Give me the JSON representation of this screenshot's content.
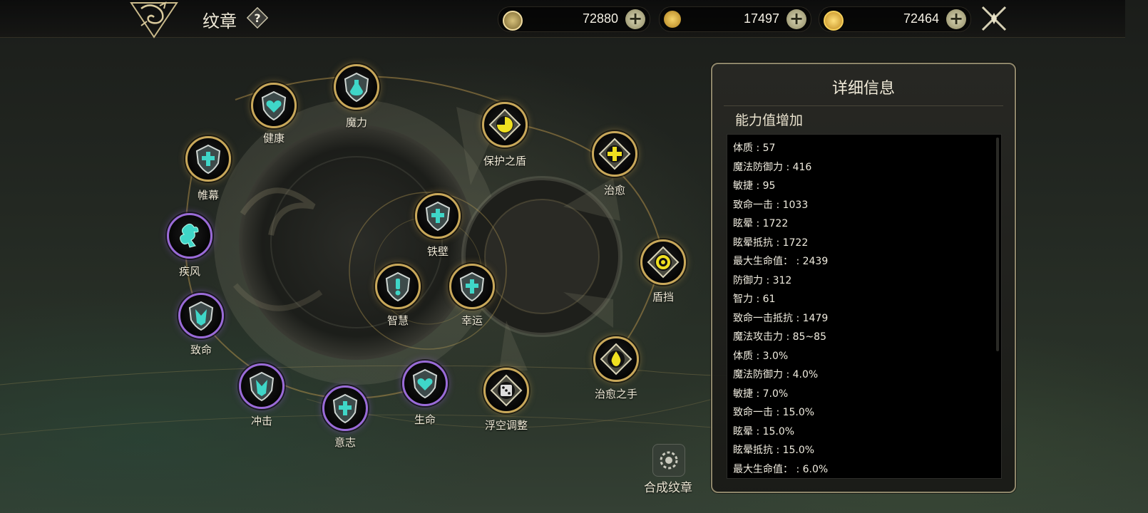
{
  "header": {
    "title": "纹章",
    "help_icon": "question-icon",
    "currencies": [
      {
        "name": "c1",
        "icon": "swirl-coin-icon",
        "value": "72880"
      },
      {
        "name": "c2",
        "icon": "gold-coin-bag-icon",
        "value": "17497"
      },
      {
        "name": "c3",
        "icon": "gold-coin-icon",
        "value": "72464"
      }
    ],
    "close_icon": "crossed-swords-close-icon"
  },
  "emblems": [
    {
      "id": "jiankang",
      "label": "健康",
      "ring": "gold",
      "icon": "heart-shield-icon"
    },
    {
      "id": "moli",
      "label": "魔力",
      "ring": "gold",
      "icon": "potion-shield-icon"
    },
    {
      "id": "weimu",
      "label": "帷幕",
      "ring": "gold",
      "icon": "cross-shield-icon"
    },
    {
      "id": "jifeng",
      "label": "疾风",
      "ring": "purple",
      "icon": "wind-icon"
    },
    {
      "id": "zhiming",
      "label": "致命",
      "ring": "purple",
      "icon": "strike-shield-icon"
    },
    {
      "id": "chongji",
      "label": "冲击",
      "ring": "purple",
      "icon": "strike-shield-icon"
    },
    {
      "id": "yizhi",
      "label": "意志",
      "ring": "purple",
      "icon": "cross-shield-icon"
    },
    {
      "id": "shengming",
      "label": "生命",
      "ring": "purple",
      "icon": "heart-shield-icon"
    },
    {
      "id": "fukong",
      "label": "浮空调整",
      "ring": "gold",
      "icon": "dice-crest-icon"
    },
    {
      "id": "baohu",
      "label": "保护之盾",
      "ring": "gold",
      "icon": "pie-crest-icon"
    },
    {
      "id": "zhiyu",
      "label": "治愈",
      "ring": "gold",
      "icon": "plus-crest-icon"
    },
    {
      "id": "dundang",
      "label": "盾挡",
      "ring": "gold",
      "icon": "cycle-crest-icon"
    },
    {
      "id": "zhiyuzhishou",
      "label": "治愈之手",
      "ring": "gold",
      "icon": "drop-crest-icon"
    },
    {
      "id": "tiebi",
      "label": "铁壁",
      "ring": "gold",
      "icon": "cross-shield-icon"
    },
    {
      "id": "zhihui",
      "label": "智慧",
      "ring": "gold",
      "icon": "exclaim-shield-icon"
    },
    {
      "id": "xingyun",
      "label": "幸运",
      "ring": "gold",
      "icon": "cross-shield-icon"
    }
  ],
  "compose": {
    "label": "合成纹章",
    "icon": "compose-gear-icon"
  },
  "details": {
    "title": "详细信息",
    "subtitle": "能力值增加",
    "stats": [
      "体质 : 57",
      "魔法防御力 : 416",
      "敏捷 : 95",
      "致命一击 : 1033",
      "眩晕 : 1722",
      "眩晕抵抗 : 1722",
      "最大生命值：  : 2439",
      "防御力 : 312",
      "智力 : 61",
      "致命一击抵抗 : 1479",
      "魔法攻击力 : 85~85",
      "体质 : 3.0%",
      "魔法防御力 : 4.0%",
      "敏捷 : 7.0%",
      "致命一击 : 15.0%",
      "眩晕 : 15.0%",
      "眩晕抵抗 : 15.0%",
      "最大生命值：  : 6.0%"
    ]
  },
  "colors": {
    "gold_ring": "#c9a85a",
    "purple_ring": "#9a6bd8",
    "cyan_icon": "#3fd6c8",
    "yellow_icon": "#f0e020"
  }
}
